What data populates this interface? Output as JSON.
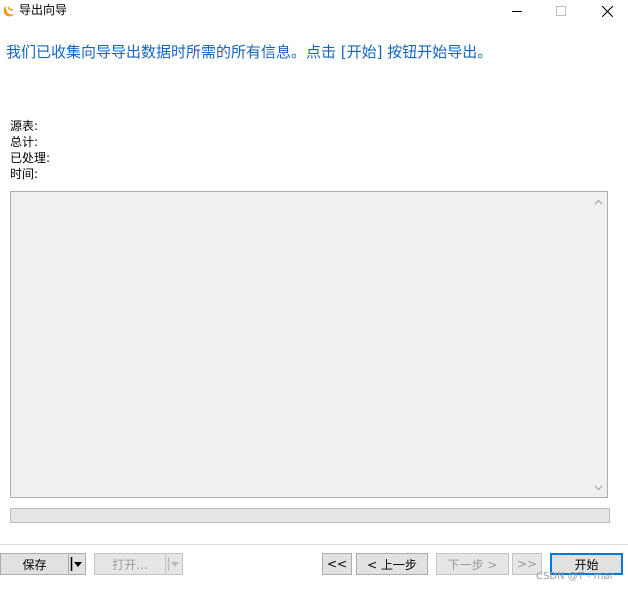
{
  "window": {
    "title": "导出向导",
    "controls": [
      "minimize",
      "maximize",
      "close"
    ]
  },
  "heading": "我们已收集向导导出数据时所需的所有信息。点击 [开始] 按钮开始导出。",
  "info": {
    "source_label": "源表:",
    "total_label": "总计:",
    "processed_label": "已处理:",
    "time_label": "时间:"
  },
  "log": {
    "content": ""
  },
  "progress": {
    "value": 0
  },
  "buttons": {
    "save": "保存",
    "open": "打开...",
    "first": "<<",
    "prev": "< 上一步",
    "next": "下一步 >",
    "last": ">>",
    "start": "开始"
  },
  "watermark": "CSDN @T - mar",
  "colors": {
    "heading": "#1565c0",
    "accent": "#0078d7",
    "icon": "#f39c12"
  }
}
